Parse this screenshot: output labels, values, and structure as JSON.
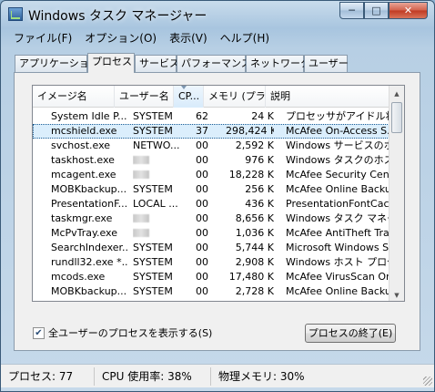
{
  "window": {
    "title": "Windows タスク マネージャー",
    "min_glyph": "─",
    "max_glyph": "□",
    "close_glyph": "✕"
  },
  "menu": [
    "ファイル(F)",
    "オプション(O)",
    "表示(V)",
    "ヘルプ(H)"
  ],
  "tabs": [
    "アプリケーション",
    "プロセス",
    "サービス",
    "パフォーマンス",
    "ネットワーク",
    "ユーザー"
  ],
  "active_tab": "プロセス",
  "columns": [
    "イメージ名",
    "ユーザー名",
    "CP...",
    "メモリ (プラ...",
    "説明"
  ],
  "sorted_column": "CP...",
  "rows": [
    {
      "name": "System Idle P...",
      "user": "SYSTEM",
      "cpu": "62",
      "mem": "24 K",
      "desc": "プロセッサがアイドル状..."
    },
    {
      "name": "mcshield.exe",
      "user": "SYSTEM",
      "cpu": "37",
      "mem": "298,424 K",
      "desc": "McAfee On-Access S...",
      "selected": true
    },
    {
      "name": "svchost.exe",
      "user": "NETWO...",
      "cpu": "00",
      "mem": "2,592 K",
      "desc": "Windows サービスのホ..."
    },
    {
      "name": "taskhost.exe",
      "user": "",
      "cpu": "00",
      "mem": "976 K",
      "desc": "Windows タスクのホスト..."
    },
    {
      "name": "mcagent.exe",
      "user": "",
      "cpu": "00",
      "mem": "18,228 K",
      "desc": "McAfee Security Cent..."
    },
    {
      "name": "MOBKbackup...",
      "user": "SYSTEM",
      "cpu": "00",
      "mem": "256 K",
      "desc": "McAfee Online Backu..."
    },
    {
      "name": "PresentationF...",
      "user": "LOCAL ...",
      "cpu": "00",
      "mem": "436 K",
      "desc": "PresentationFontCach..."
    },
    {
      "name": "taskmgr.exe",
      "user": "",
      "cpu": "00",
      "mem": "8,656 K",
      "desc": "Windows タスク マネー..."
    },
    {
      "name": "McPvTray.exe",
      "user": "",
      "cpu": "00",
      "mem": "1,036 K",
      "desc": "McAfee AntiTheft Tray"
    },
    {
      "name": "SearchIndexer...",
      "user": "SYSTEM",
      "cpu": "00",
      "mem": "5,744 K",
      "desc": "Microsoft Windows Se..."
    },
    {
      "name": "rundll32.exe *...",
      "user": "SYSTEM",
      "cpu": "00",
      "mem": "2,908 K",
      "desc": "Windows ホスト プロセ..."
    },
    {
      "name": "mcods.exe",
      "user": "SYSTEM",
      "cpu": "00",
      "mem": "17,480 K",
      "desc": "McAfee VirusScan On..."
    },
    {
      "name": "MOBKbackup...",
      "user": "SYSTEM",
      "cpu": "00",
      "mem": "2,728 K",
      "desc": "McAfee Online Backu..."
    },
    {
      "name": "svchost.exe",
      "user": "LOCAL ...",
      "cpu": "00",
      "mem": "10,692 K",
      "desc": "Windows サービスのホ..."
    }
  ],
  "show_all_users_label": "全ユーザーのプロセスを表示する(S)",
  "show_all_users_checked": true,
  "end_process_label": "プロセスの終了(E)",
  "status": {
    "processes": "プロセス: 77",
    "cpu": "CPU 使用率: 38%",
    "memory": "物理メモリ: 30%"
  }
}
